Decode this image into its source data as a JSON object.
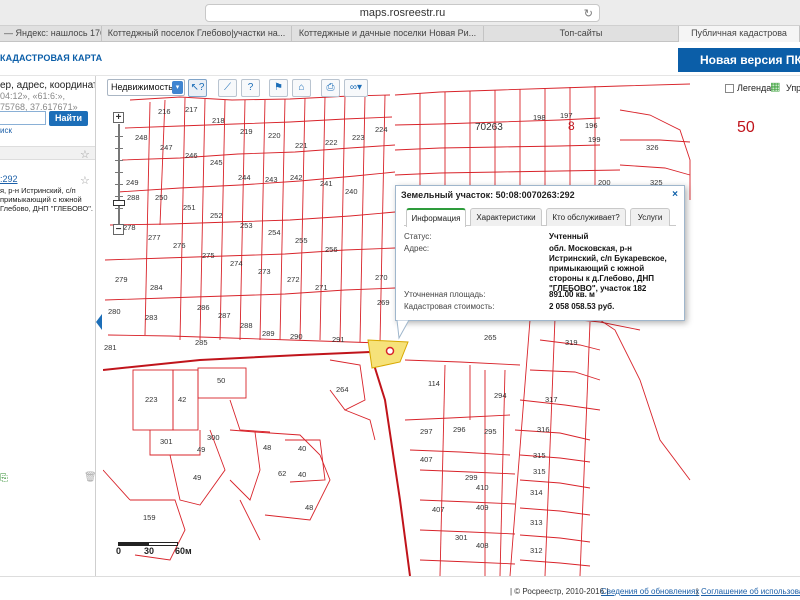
{
  "browser": {
    "url": "maps.rosreestr.ru",
    "tabs": [
      "— Яндекс: нашлось 176 ...",
      "Коттеджный поселок Глебово|участки на...",
      "Коттеджные и дачные поселки Новая Ри...",
      "Топ-сайты",
      "Публичная кадастрова"
    ]
  },
  "header": {
    "title": "КАДАСТРОВАЯ КАРТА",
    "new_version": "Новая версия ПК"
  },
  "search": {
    "hint_line1": "ер, адрес, координата:",
    "hint_line2": "04:12», «61:6:»,",
    "hint_line3": "75768, 37.617671»",
    "find_label": "Найти",
    "extended_label": "иск"
  },
  "result": {
    "link": ":292",
    "desc": "я, р-н Истринский, с/п примыкающий с южной Глебово, ДНП \"ГЛЕБОВО\"."
  },
  "toolbar": {
    "layer_select": "Недвижимость",
    "legend_label": "Легенда",
    "manage_label": "Упра"
  },
  "icons": {
    "select_arrow": "chevron-down-icon",
    "identify": "pointer-question-icon",
    "measure": "ruler-icon",
    "info": "question-box-icon",
    "pin": "pushpin-icon",
    "shop": "building-icon",
    "print": "printer-icon",
    "link": "chain-link-icon",
    "layers": "layers-grid-icon",
    "close": "close-icon",
    "star": "star-icon",
    "trash": "trash-icon"
  },
  "map": {
    "block_label": "70263",
    "region_label": "50",
    "region_label_small": "8",
    "parcel_numbers": [
      "216",
      "217",
      "218",
      "219",
      "220",
      "221",
      "222",
      "223",
      "224",
      "225",
      "198",
      "197",
      "196",
      "248",
      "247",
      "246",
      "245",
      "244",
      "243",
      "242",
      "241",
      "240",
      "239",
      "238",
      "237",
      "236",
      "250",
      "251",
      "252",
      "253",
      "254",
      "255",
      "256",
      "257",
      "258",
      "277",
      "276",
      "275",
      "274",
      "273",
      "272",
      "271",
      "270",
      "269",
      "268",
      "267",
      "279",
      "284",
      "280",
      "283",
      "281",
      "285",
      "286",
      "287",
      "288",
      "289",
      "290",
      "291",
      "292",
      "223",
      "42",
      "50",
      "264",
      "114",
      "297",
      "296",
      "295",
      "294",
      "293",
      "299",
      "410",
      "409",
      "407",
      "406",
      "408",
      "301",
      "300",
      "49",
      "48",
      "40",
      "62",
      "159",
      "48",
      "319",
      "317",
      "316",
      "315",
      "314",
      "313",
      "312",
      "326",
      "325",
      "200",
      "201",
      "199",
      "117"
    ]
  },
  "popup": {
    "title": "Земельный участок: 50:08:0070263:292",
    "tabs": [
      "Информация",
      "Характеристики",
      "Кто обслуживает?",
      "Услуги"
    ],
    "status_label": "Статус:",
    "status_value": "Учтенный",
    "address_label": "Адрес:",
    "address_value": "обл. Московская, р-н Истринский, с/п Букаревское, примыкающий с южной стороны к д.Глебово, ДНП \"ГЛЕБОВО\", участок 182",
    "area_label": "Уточненная площадь:",
    "area_value": "891.00 кв. м",
    "cost_label": "Кадастровая стоимость:",
    "cost_value": "2 058 058.53 руб."
  },
  "scale": {
    "s0": "0",
    "s1": "30",
    "s2": "60м"
  },
  "footer": {
    "copyright": "| © Росреестр, 2010-2016 |",
    "link1": "Сведения об обновлениях",
    "link2": "Соглашение об использовани"
  }
}
